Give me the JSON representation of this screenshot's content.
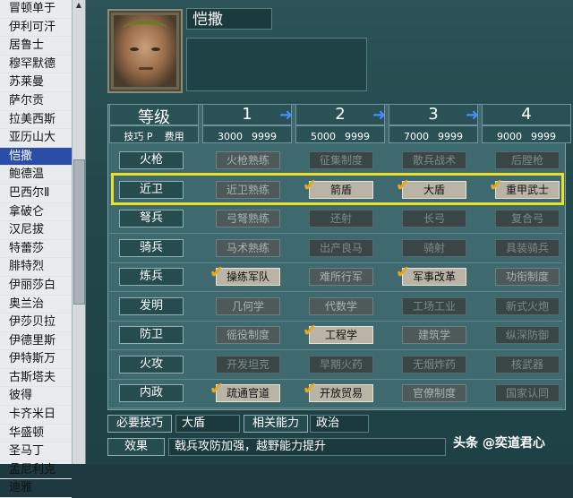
{
  "list": {
    "items": [
      "冒顿单于",
      "伊利可汗",
      "居鲁士",
      "穆罕默德",
      "苏莱曼",
      "萨尔贡",
      "拉美西斯",
      "亚历山大",
      "恺撒",
      "鲍德温",
      "巴西尔Ⅱ",
      "拿破仑",
      "汉尼拔",
      "特蕾莎",
      "腓特烈",
      "伊丽莎白",
      "奥兰治",
      "伊莎贝拉",
      "伊德里斯",
      "伊特斯万",
      "古斯塔夫",
      "彼得",
      "卡齐米日",
      "华盛顿",
      "圣马丁",
      "孟尼利克",
      "迪雅"
    ],
    "selected_index": 8
  },
  "leader": {
    "name": "恺撒"
  },
  "header": {
    "level_label": "等级",
    "skill_label": "技巧 P",
    "cost_label": "费用",
    "levels": [
      {
        "num": "1",
        "skill": "3000",
        "cost": "9999"
      },
      {
        "num": "2",
        "skill": "5000",
        "cost": "9999"
      },
      {
        "num": "3",
        "skill": "7000",
        "cost": "9999"
      },
      {
        "num": "4",
        "skill": "9000",
        "cost": "9999"
      }
    ]
  },
  "rows": [
    {
      "cat": "火枪",
      "cells": [
        {
          "t": "火枪熟练",
          "s": "off"
        },
        {
          "t": "征集制度",
          "s": "dim"
        },
        {
          "t": "散兵战术",
          "s": "dim"
        },
        {
          "t": "后膛枪",
          "s": "dim"
        }
      ]
    },
    {
      "cat": "近卫",
      "cells": [
        {
          "t": "近卫熟练",
          "s": "off"
        },
        {
          "t": "箭盾",
          "s": "on",
          "c": true
        },
        {
          "t": "大盾",
          "s": "on",
          "c": true
        },
        {
          "t": "重甲武士",
          "s": "on",
          "c": true
        }
      ]
    },
    {
      "cat": "弩兵",
      "cells": [
        {
          "t": "弓弩熟练",
          "s": "off"
        },
        {
          "t": "还射",
          "s": "dim"
        },
        {
          "t": "长弓",
          "s": "dim"
        },
        {
          "t": "复合弓",
          "s": "dim"
        }
      ]
    },
    {
      "cat": "骑兵",
      "cells": [
        {
          "t": "马术熟练",
          "s": "off"
        },
        {
          "t": "出产良马",
          "s": "dim"
        },
        {
          "t": "骑射",
          "s": "dim"
        },
        {
          "t": "具装骑兵",
          "s": "dim"
        }
      ]
    },
    {
      "cat": "炼兵",
      "cells": [
        {
          "t": "操练军队",
          "s": "on",
          "c": true
        },
        {
          "t": "难所行军",
          "s": "off"
        },
        {
          "t": "军事改革",
          "s": "on",
          "c": true
        },
        {
          "t": "功衔制度",
          "s": "off"
        }
      ]
    },
    {
      "cat": "发明",
      "cells": [
        {
          "t": "几何学",
          "s": "off"
        },
        {
          "t": "代数学",
          "s": "off"
        },
        {
          "t": "工场工业",
          "s": "dim"
        },
        {
          "t": "新式火炮",
          "s": "dim"
        }
      ]
    },
    {
      "cat": "防卫",
      "cells": [
        {
          "t": "徭役制度",
          "s": "off"
        },
        {
          "t": "工程学",
          "s": "on",
          "c": true
        },
        {
          "t": "建筑学",
          "s": "off"
        },
        {
          "t": "纵深防御",
          "s": "dim"
        }
      ]
    },
    {
      "cat": "火攻",
      "cells": [
        {
          "t": "开发坦克",
          "s": "dim"
        },
        {
          "t": "早期火药",
          "s": "dim"
        },
        {
          "t": "无烟炸药",
          "s": "dim"
        },
        {
          "t": "核武器",
          "s": "dim"
        }
      ]
    },
    {
      "cat": "内政",
      "cells": [
        {
          "t": "疏通官道",
          "s": "on",
          "c": true
        },
        {
          "t": "开放贸易",
          "s": "on",
          "c": true
        },
        {
          "t": "官僚制度",
          "s": "off"
        },
        {
          "t": "国家认同",
          "s": "dim"
        }
      ]
    }
  ],
  "bottom": {
    "req_label": "必要技巧",
    "req_value": "大盾",
    "rel_label": "相关能力",
    "rel_value": "政治",
    "effect_label": "效果",
    "effect_value": "戟兵攻防加强，越野能力提升"
  },
  "watermark": "头条 @奕道君心",
  "colors": {
    "highlight": "#e8e02a",
    "check": "#e9a51c",
    "arrow": "#4a8cff"
  }
}
